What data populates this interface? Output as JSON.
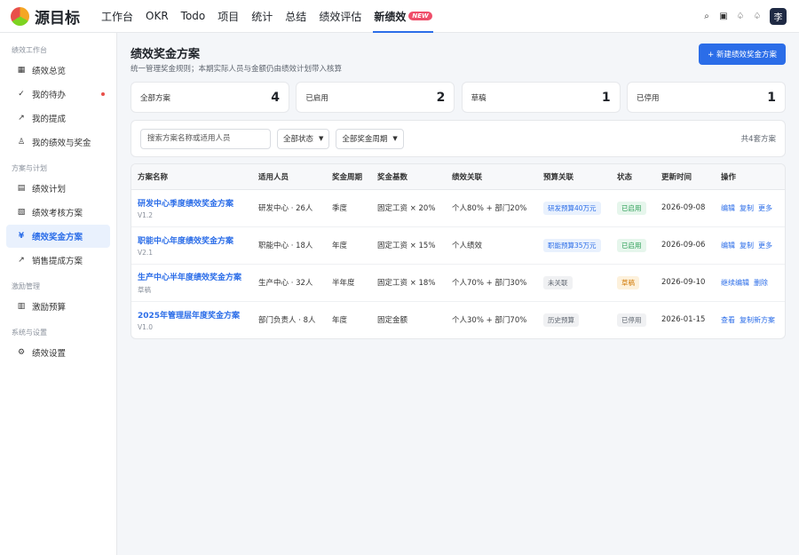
{
  "app": {
    "brand": "源目标"
  },
  "nav": {
    "items": [
      "工作台",
      "OKR",
      "Todo",
      "项目",
      "统计",
      "总结",
      "绩效评估",
      "新绩效"
    ],
    "new_badge": "NEW"
  },
  "topbar": {
    "avatar_text": "李"
  },
  "sidebar": {
    "groups": [
      {
        "title": "绩效工作台",
        "items": [
          "绩效总览",
          "我的待办",
          "我的提成",
          "我的绩效与奖金"
        ]
      },
      {
        "title": "方案与计划",
        "items": [
          "绩效计划",
          "绩效考核方案",
          "绩效奖金方案",
          "销售提成方案"
        ]
      },
      {
        "title": "激励管理",
        "items": [
          "激励预算"
        ]
      },
      {
        "title": "系统与设置",
        "items": [
          "绩效设置"
        ]
      }
    ]
  },
  "page": {
    "title": "绩效奖金方案",
    "subtitle": "统一管理奖金规则；本期实际人员与金额仍由绩效计划带入核算",
    "new_button": "+ 新建绩效奖金方案"
  },
  "stats": [
    {
      "label": "全部方案",
      "value": "4"
    },
    {
      "label": "已启用",
      "value": "2"
    },
    {
      "label": "草稿",
      "value": "1"
    },
    {
      "label": "已停用",
      "value": "1"
    }
  ],
  "filters": {
    "search_placeholder": "搜索方案名称或适用人员",
    "status": "全部状态",
    "period": "全部奖金周期",
    "total": "共4套方案"
  },
  "table": {
    "headers": [
      "方案名称",
      "适用人员",
      "奖金周期",
      "奖金基数",
      "绩效关联",
      "预算关联",
      "状态",
      "更新时间",
      "操作"
    ],
    "rows": [
      {
        "name": "研发中心季度绩效奖金方案",
        "version": "V1.2",
        "people": "研发中心 · 26人",
        "period": "季度",
        "base": "固定工资 × 20%",
        "link": "个人80% + 部门20%",
        "budget": "研发预算40万元",
        "status": "已启用",
        "updated": "2026-09-08",
        "ops": [
          "编辑",
          "复制",
          "更多"
        ]
      },
      {
        "name": "职能中心年度绩效奖金方案",
        "version": "V2.1",
        "people": "职能中心 · 18人",
        "period": "年度",
        "base": "固定工资 × 15%",
        "link": "个人绩效",
        "budget": "职能预算35万元",
        "status": "已启用",
        "updated": "2026-09-06",
        "ops": [
          "编辑",
          "复制",
          "更多"
        ]
      },
      {
        "name": "生产中心半年度绩效奖金方案",
        "version": "草稿",
        "people": "生产中心 · 32人",
        "period": "半年度",
        "base": "固定工资 × 18%",
        "link": "个人70% + 部门30%",
        "budget": "未关联",
        "status": "草稿",
        "updated": "2026-09-10",
        "ops": [
          "继续编辑",
          "删除"
        ]
      },
      {
        "name": "2025年管理层年度奖金方案",
        "version": "V1.0",
        "people": "部门负责人 · 8人",
        "period": "年度",
        "base": "固定金额",
        "link": "个人30% + 部门70%",
        "budget": "历史预算",
        "status": "已停用",
        "updated": "2026-01-15",
        "ops": [
          "查看",
          "复制新方案"
        ]
      }
    ]
  },
  "colors": {
    "accent": "#2b6de8",
    "enabled": "#2b9d55",
    "draft": "#d27b08",
    "disabled": "#5f6670"
  }
}
